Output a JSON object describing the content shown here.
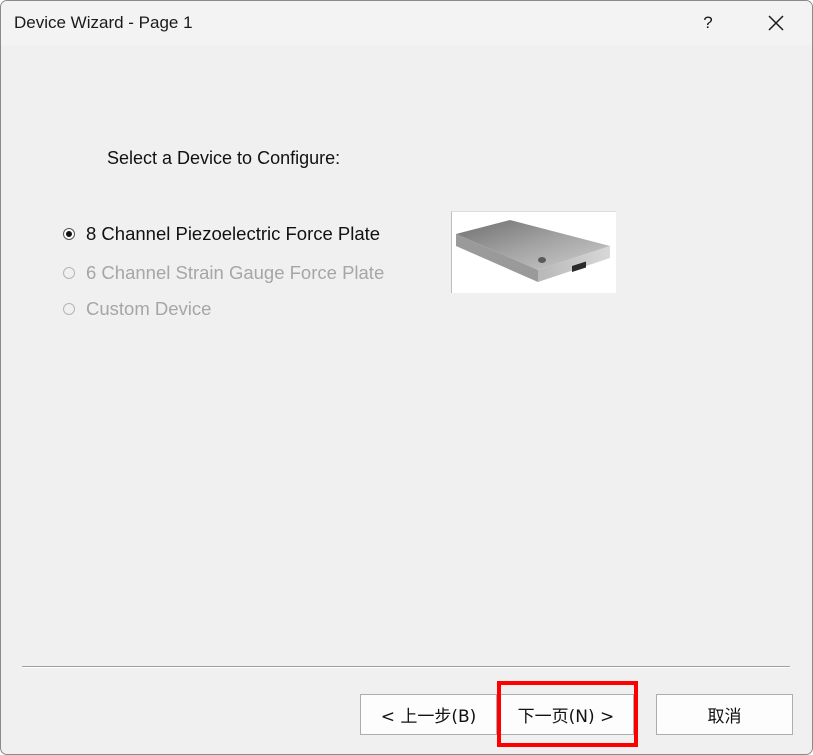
{
  "window": {
    "title": "Device Wizard - Page 1",
    "help_label": "?",
    "close_icon": "close-icon"
  },
  "main": {
    "prompt": "Select a Device to Configure:",
    "options": [
      {
        "label": "8 Channel Piezoelectric Force Plate",
        "selected": true,
        "enabled": true
      },
      {
        "label": "6 Channel Strain Gauge Force Plate",
        "selected": false,
        "enabled": false
      },
      {
        "label": "Custom Device",
        "selected": false,
        "enabled": false
      }
    ],
    "image_icon": "force-plate-image"
  },
  "footer": {
    "back_label": "< 上一步(B)",
    "next_label": "下一页(N) >",
    "cancel_label": "取消"
  },
  "colors": {
    "highlight": "#ff0000",
    "disabled_text": "#a6a6a6",
    "window_bg": "#f0f0f0"
  }
}
